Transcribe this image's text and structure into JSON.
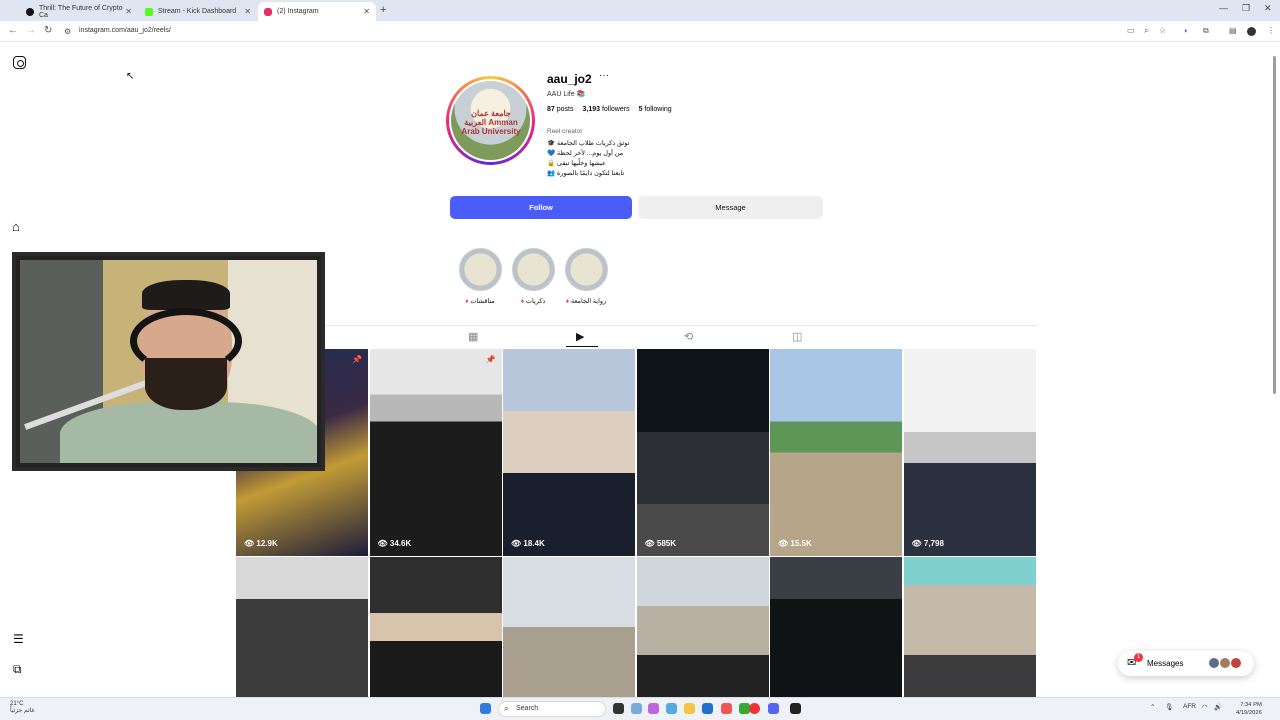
{
  "browser": {
    "tabs": [
      {
        "title": "Thrill: The Future of Crypto Ca",
        "color": "#111111"
      },
      {
        "title": "Stream - Kick Dashboard",
        "color": "#53fc18"
      },
      {
        "title": "(2) Instagram",
        "color": "#e1306c"
      }
    ],
    "url": "instagram.com/aau_jo2/reels/"
  },
  "profile": {
    "username": "aau_jo2",
    "category": "AAU Life 📚",
    "posts_count": "87",
    "posts_label": "posts",
    "followers_count": "3,193",
    "followers_label": "followers",
    "following_count": "5",
    "following_label": "following",
    "bio_title": "Reel creator",
    "bio_lines": [
      "🎓 توثق ذكريات طلاب الجامعة",
      "💙 من أول يوم... لآخر لحظة",
      "🔒 عيشها وخلّيها تبقى",
      "👥 تابعنا لتكون دايمًا بالصورة"
    ],
    "avatar_text": "جامعة عمان العربية Amman Arab University",
    "follow_label": "Follow",
    "message_label": "Message"
  },
  "highlights": [
    {
      "label": "مناقشات"
    },
    {
      "label": "ذكريات"
    },
    {
      "label": "رواية الجامعة"
    }
  ],
  "reels": [
    {
      "views": "12.9K",
      "bg": "linear-gradient(160deg,#1c2d54,#3a2a45 40%,#c29b36 60%,#1b1c3a)",
      "pinned": true
    },
    {
      "views": "34.6K",
      "bg": "linear-gradient(180deg,#e7e7e7 0 22%,#b8b8b8 22% 35%,#1c1c1c 35%)",
      "pinned": true
    },
    {
      "views": "18.4K",
      "bg": "linear-gradient(180deg,#b9c7dc 0 30%,#dccfbf 30% 60%,#1a1f2e 60%)",
      "pinned": false
    },
    {
      "views": "585K",
      "bg": "linear-gradient(180deg,#0f1419 0 40%,#2b2f35 40% 75%,#4a4a4a 75%)",
      "pinned": false
    },
    {
      "views": "15.5K",
      "bg": "linear-gradient(180deg,#a9c6e6 0 35%,#5d9657 35% 50%,#b7a58a 50%)",
      "pinned": false
    },
    {
      "views": "7,798",
      "bg": "linear-gradient(180deg,#f2f2f2 0 40%,#c6c6c6 40% 55%,#2c3140 55%)",
      "pinned": false
    },
    {
      "views": "",
      "bg": "linear-gradient(180deg,#d9d9d9 0 30%,#3b3b3b 30%)",
      "pinned": false
    },
    {
      "views": "",
      "bg": "linear-gradient(180deg,#2e2e2e 0 40%,#d8c4ad 40% 60%,#1a1a1a 60%)",
      "pinned": false
    },
    {
      "views": "",
      "bg": "linear-gradient(180deg,#d7dde2 0 50%,#a89f8e 50%)",
      "pinned": false
    },
    {
      "views": "",
      "bg": "linear-gradient(180deg,#cfd6dc 0 35%,#b8b0a2 35% 70%,#222 70%)",
      "pinned": false
    },
    {
      "views": "",
      "bg": "linear-gradient(180deg,#3a3f46 0 30%,#0f1316 30%)",
      "pinned": false
    },
    {
      "views": "",
      "bg": "linear-gradient(180deg,#7fd1d0 0 20%,#c4b8a9 20% 70%,#3b3a3d 70%)",
      "pinned": false
    }
  ],
  "messages": {
    "label": "Messages",
    "badge": "1"
  },
  "taskbar": {
    "weather_temp": "21°C",
    "weather_desc": "غائم جزئياً",
    "search_label": "Search",
    "lang": "AFR",
    "time": "7:34 PM",
    "date": "4/19/2026"
  },
  "colors": {
    "follow_blue": "#4a5df9",
    "story_ring": "#ee2a7b"
  }
}
